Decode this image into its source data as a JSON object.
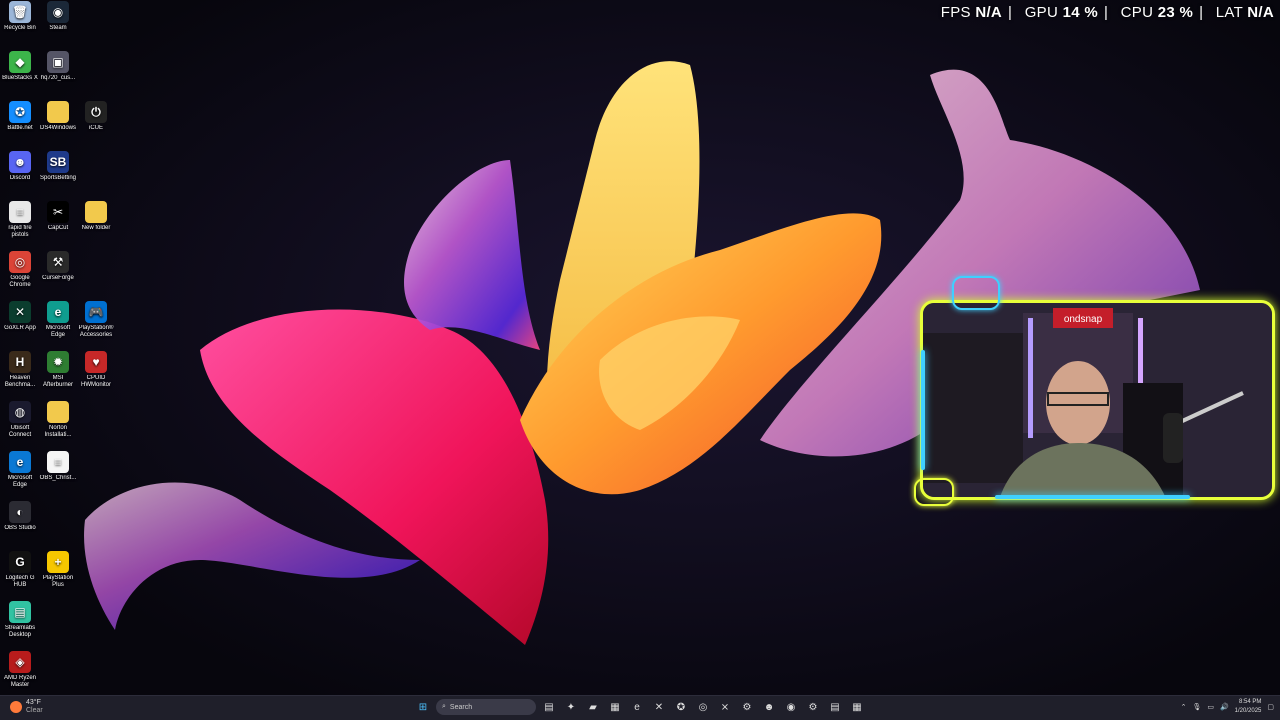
{
  "desktop": {
    "icons": [
      {
        "label": "Recycle Bin",
        "icon": "recycle-bin-icon",
        "color": "#9bb6d8",
        "glyph": "🗑"
      },
      {
        "label": "Steam",
        "icon": "steam-icon",
        "color": "#1b2838",
        "glyph": "◉"
      },
      {
        "label": "BlueStacks X",
        "icon": "bluestacks-icon",
        "color": "#3cb44a",
        "glyph": "◆"
      },
      {
        "label": "hq720_cus...",
        "icon": "image-file-icon",
        "color": "#555566",
        "glyph": "▣"
      },
      {
        "label": "Battle.net",
        "icon": "battlenet-icon",
        "color": "#148eff",
        "glyph": "✪"
      },
      {
        "label": "DS4Windows",
        "icon": "folder-icon",
        "color": "#f2c94c",
        "glyph": ""
      },
      {
        "label": "iCUE",
        "icon": "icue-icon",
        "color": "#222222",
        "glyph": "⏻"
      },
      {
        "label": "Discord",
        "icon": "discord-icon",
        "color": "#5865f2",
        "glyph": "☻"
      },
      {
        "label": "SportsBetting",
        "icon": "sportsbetting-icon",
        "color": "#1e3a8a",
        "glyph": "SB"
      },
      {
        "label": "rapid fire pistols",
        "icon": "text-file-icon",
        "color": "#e8e8e8",
        "glyph": "≡"
      },
      {
        "label": "CapCut",
        "icon": "capcut-icon",
        "color": "#000000",
        "glyph": "✂"
      },
      {
        "label": "New folder",
        "icon": "folder-icon",
        "color": "#f2c94c",
        "glyph": ""
      },
      {
        "label": "Google Chrome",
        "icon": "chrome-icon",
        "color": "#db4437",
        "glyph": "◎"
      },
      {
        "label": "CurseForge",
        "icon": "curseforge-icon",
        "color": "#2a2a2a",
        "glyph": "⚒"
      },
      {
        "label": "GoXLR App",
        "icon": "goxlr-icon",
        "color": "#0b3d2e",
        "glyph": "✕"
      },
      {
        "label": "Microsoft Edge",
        "icon": "edge-icon",
        "color": "#0f9d8f",
        "glyph": "e"
      },
      {
        "label": "PlayStation® Accessories",
        "icon": "playstation-accessories-icon",
        "color": "#0070d1",
        "glyph": "🎮"
      },
      {
        "label": "Heaven Benchma...",
        "icon": "heaven-benchmark-icon",
        "color": "#3a2a1a",
        "glyph": "H"
      },
      {
        "label": "MSI Afterburner",
        "icon": "msi-afterburner-icon",
        "color": "#2e7d32",
        "glyph": "✹"
      },
      {
        "label": "CPUID HWMonitor",
        "icon": "hwmonitor-icon",
        "color": "#c62828",
        "glyph": "♥"
      },
      {
        "label": "Ubisoft Connect",
        "icon": "ubisoft-icon",
        "color": "#1a1a2e",
        "glyph": "◍"
      },
      {
        "label": "Norton Installati...",
        "icon": "folder-icon",
        "color": "#f2c94c",
        "glyph": ""
      },
      {
        "label": "Microsoft Edge",
        "icon": "edge-icon",
        "color": "#0a78d4",
        "glyph": "e"
      },
      {
        "label": "OBS_Christ...",
        "icon": "text-file-icon",
        "color": "#f5f5f5",
        "glyph": "≡"
      },
      {
        "label": "OBS Studio",
        "icon": "obs-icon",
        "color": "#2b2b33",
        "glyph": "◐"
      },
      {
        "label": "Logitech G HUB",
        "icon": "logitech-ghub-icon",
        "color": "#111111",
        "glyph": "G"
      },
      {
        "label": "PlayStation Plus",
        "icon": "playstation-plus-icon",
        "color": "#f6c700",
        "glyph": "+"
      },
      {
        "label": "Streamlabs Desktop",
        "icon": "streamlabs-icon",
        "color": "#31c3a2",
        "glyph": "▤"
      },
      {
        "label": "AMD Ryzen Master",
        "icon": "amd-ryzen-master-icon",
        "color": "#b71c1c",
        "glyph": "◈"
      }
    ]
  },
  "perf": {
    "fps_label": "FPS",
    "fps_value": "N/A",
    "gpu_label": "GPU",
    "gpu_value": "14 %",
    "cpu_label": "CPU",
    "cpu_value": "23 %",
    "lat_label": "LAT",
    "lat_value": "N/A",
    "separator": "|"
  },
  "webcam": {
    "sign_text": "ondsnap"
  },
  "taskbar": {
    "weather_temp": "43°F",
    "weather_cond": "Clear",
    "search_placeholder": "Search",
    "apps": [
      "file-explorer-icon",
      "copilot-icon",
      "folder-icon",
      "store-icon",
      "edge-icon",
      "goxlr-icon",
      "battlenet-icon",
      "chrome-icon",
      "xbox-icon",
      "tool-icon",
      "discord-icon",
      "steam-icon",
      "settings-icon",
      "streamlabs-icon",
      "calculator-icon"
    ],
    "clock_time": "8:54 PM",
    "clock_date": "1/20/2025"
  },
  "colors": {
    "frame_yellow": "#e8ff3a",
    "frame_blue": "#3fd0ff",
    "desktop_bg": "#0c0a16"
  }
}
